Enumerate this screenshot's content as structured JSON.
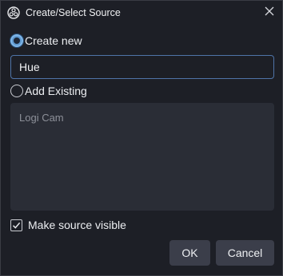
{
  "window": {
    "title": "Create/Select Source",
    "app_icon": "obs-logo-icon",
    "close_icon": "close-icon"
  },
  "options": {
    "create_new_label": "Create new",
    "create_new_selected": true,
    "add_existing_label": "Add Existing",
    "add_existing_selected": false
  },
  "name_input": {
    "value": "Hue"
  },
  "existing_sources": {
    "items": [
      "Logi Cam"
    ]
  },
  "visibility": {
    "label": "Make source visible",
    "checked": true
  },
  "buttons": {
    "ok_label": "OK",
    "cancel_label": "Cancel"
  },
  "colors": {
    "background": "#1d1f26",
    "accent": "#5f99d0",
    "input_border": "#4f74a8",
    "list_background": "#2a2d36",
    "button_background": "#3b3e4a"
  }
}
